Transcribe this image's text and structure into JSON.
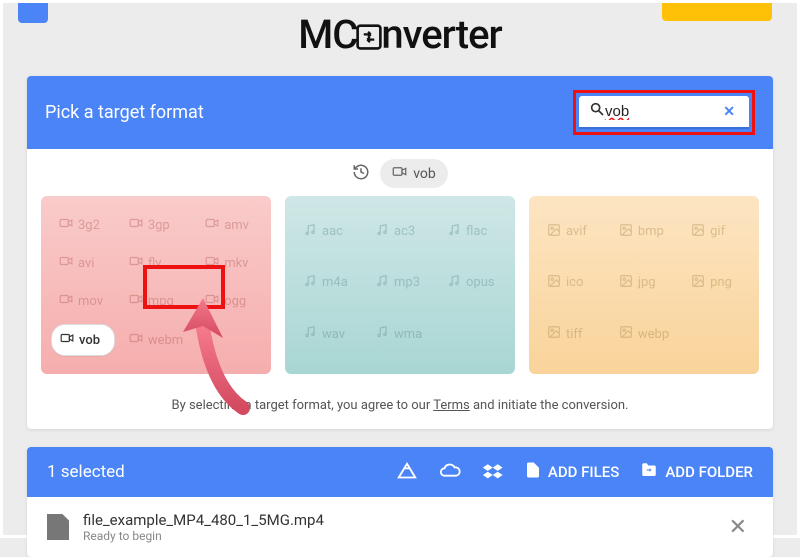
{
  "brand": {
    "prefix": "MC",
    "suffix": "nverter"
  },
  "header": {
    "title": "Pick a target format"
  },
  "search": {
    "value": "vob",
    "placeholder": ""
  },
  "recent": {
    "label": "vob"
  },
  "formats": {
    "video": [
      "3g2",
      "3gp",
      "amv",
      "avi",
      "flv",
      "mkv",
      "mov",
      "mpg",
      "ogg",
      "vob",
      "webm"
    ],
    "audio": [
      "aac",
      "ac3",
      "flac",
      "m4a",
      "mp3",
      "opus",
      "wav",
      "wma"
    ],
    "image": [
      "avif",
      "bmp",
      "gif",
      "ico",
      "jpg",
      "png",
      "tiff",
      "webp"
    ]
  },
  "terms": {
    "pre": "By selecting a target format, you agree to our ",
    "link": "Terms",
    "post": " and initiate the conversion."
  },
  "selection": {
    "count_text": "1 selected",
    "add_files": "ADD FILES",
    "add_folder": "ADD FOLDER"
  },
  "file": {
    "name": "file_example_MP4_480_1_5MG.mp4",
    "status": "Ready to begin"
  },
  "colors": {
    "accent": "#4a84f7",
    "highlight": "#e11",
    "cta_yellow": "#ffc107"
  }
}
